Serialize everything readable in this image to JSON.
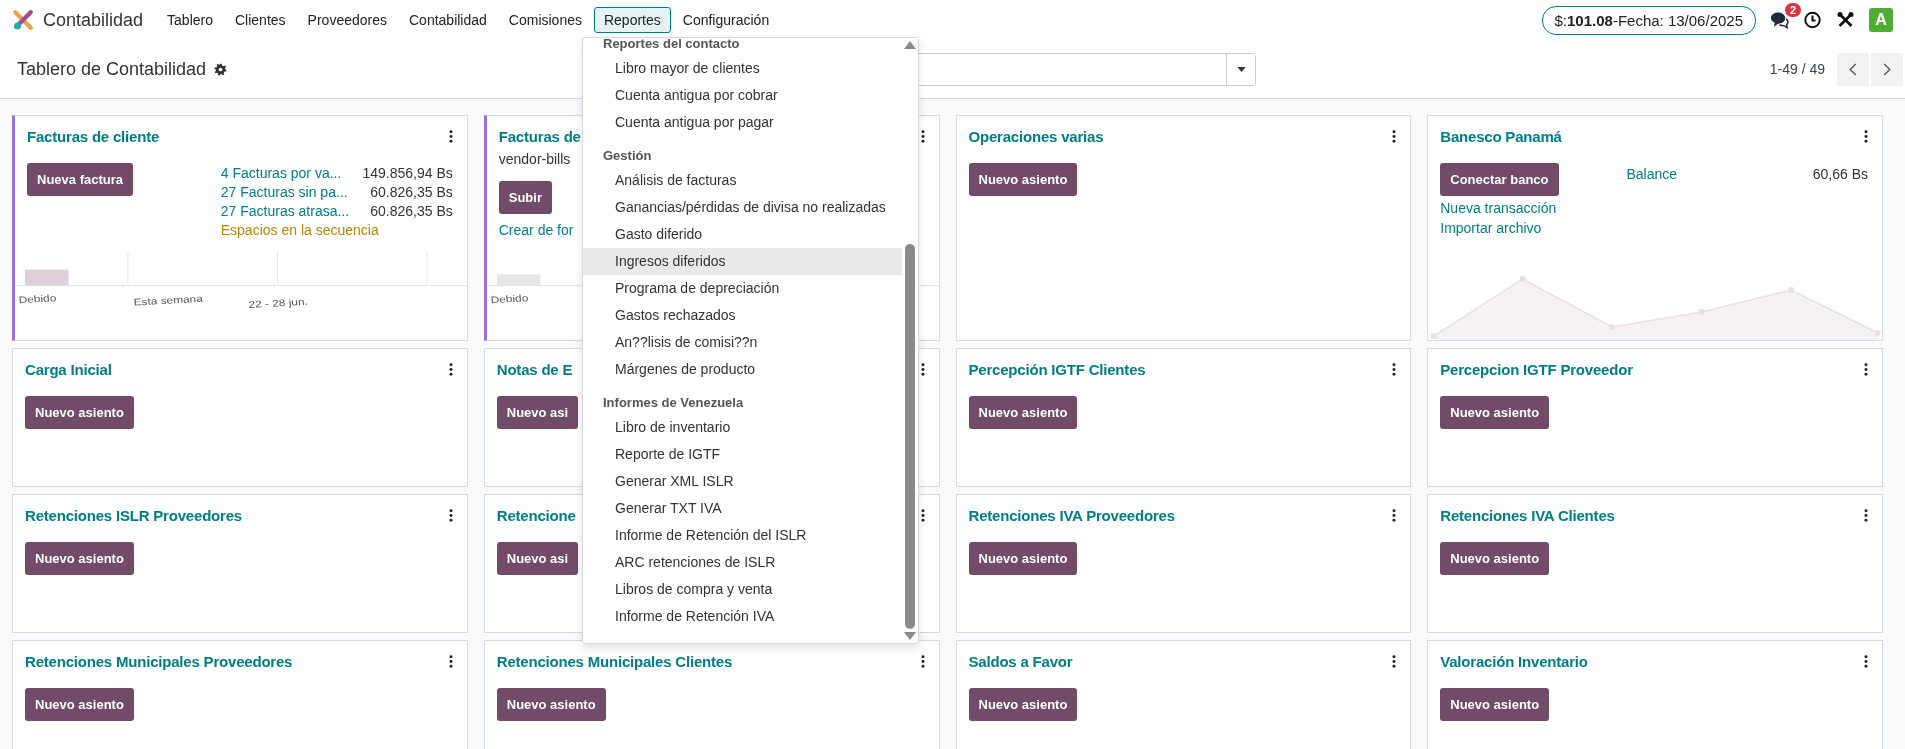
{
  "navbar": {
    "app": "Contabilidad",
    "menu": [
      {
        "label": "Tablero",
        "selected": false
      },
      {
        "label": "Clientes",
        "selected": false
      },
      {
        "label": "Proveedores",
        "selected": false
      },
      {
        "label": "Contabilidad",
        "selected": false
      },
      {
        "label": "Comisiones",
        "selected": false
      },
      {
        "label": "Reportes",
        "selected": true
      },
      {
        "label": "Configuración",
        "selected": false
      }
    ],
    "rate_pill": "$:**101.08**-Fecha: 13/06/2025",
    "messages_badge": "2",
    "avatar": "A"
  },
  "control_panel": {
    "title": "Tablero de Contabilidad",
    "pager": "1-49 / 49"
  },
  "cards": [
    {
      "kind": "sales",
      "title": "Facturas de cliente",
      "button": "Nueva factura",
      "stats": [
        {
          "label": "4 Facturas por va...",
          "amount": "149.856,94 Bs"
        },
        {
          "label": "27 Facturas sin pa...",
          "amount": "60.826,35 Bs"
        },
        {
          "label": "27 Facturas atrasa...",
          "amount": "60.826,35 Bs"
        }
      ],
      "warning": "Espacios en la secuencia",
      "chart_labels": [
        "Debido",
        "Esta semana",
        "22 - 28 jun."
      ]
    },
    {
      "kind": "purchase",
      "title": "Facturas de",
      "subtitle": "vendor-bills",
      "button": "Subir",
      "link": "Crear de for",
      "chart_labels": [
        "Debido"
      ]
    },
    {
      "kind": "general",
      "title": "Operaciones varias",
      "button": "Nuevo asiento"
    },
    {
      "kind": "bank",
      "title": "Banesco Panamá",
      "button": "Conectar banco",
      "balance_label": "Balance",
      "balance": "60,66 Bs",
      "links": [
        "Nueva transacción",
        "Importar archivo"
      ]
    },
    {
      "kind": "general",
      "title": "Carga Inicial",
      "button": "Nuevo asiento"
    },
    {
      "kind": "general",
      "title": "Notas de E",
      "button": "Nuevo asi"
    },
    {
      "kind": "general",
      "title": "Percepción IGTF Clientes",
      "button": "Nuevo asiento"
    },
    {
      "kind": "general",
      "title": "Percepcion IGTF Proveedor",
      "button": "Nuevo asiento"
    },
    {
      "kind": "general",
      "title": "Retenciones ISLR Proveedores",
      "button": "Nuevo asiento"
    },
    {
      "kind": "general",
      "title": "Retencione",
      "button": "Nuevo asi"
    },
    {
      "kind": "general",
      "title": "Retenciones IVA Proveedores",
      "button": "Nuevo asiento"
    },
    {
      "kind": "general",
      "title": "Retenciones IVA Clientes",
      "button": "Nuevo asiento"
    },
    {
      "kind": "general",
      "title": "Retenciones Municipales Proveedores",
      "button": "Nuevo asiento"
    },
    {
      "kind": "general",
      "title": "Retenciones Municipales Clientes",
      "button": "Nuevo asiento"
    },
    {
      "kind": "general",
      "title": "Saldos a Favor",
      "button": "Nuevo asiento"
    },
    {
      "kind": "general",
      "title": "Valoración Inventario",
      "button": "Nuevo asiento"
    }
  ],
  "reports_menu": {
    "sections": [
      {
        "header": "Reportes del contacto",
        "items": [
          {
            "label": "Libro mayor de clientes",
            "selected": false
          },
          {
            "label": "Cuenta antigua por cobrar",
            "selected": false
          },
          {
            "label": "Cuenta antigua por pagar",
            "selected": false
          }
        ]
      },
      {
        "header": "Gestión",
        "items": [
          {
            "label": "Análisis de facturas",
            "selected": false
          },
          {
            "label": "Ganancias/pérdidas de divisa no realizadas",
            "selected": false
          },
          {
            "label": "Gasto diferido",
            "selected": false
          },
          {
            "label": "Ingresos diferidos",
            "selected": true
          },
          {
            "label": "Programa de depreciación",
            "selected": false
          },
          {
            "label": "Gastos rechazados",
            "selected": false
          },
          {
            "label": "An??lisis de comisi??n",
            "selected": false
          },
          {
            "label": "Márgenes de producto",
            "selected": false
          }
        ]
      },
      {
        "header": "Informes de Venezuela",
        "items": [
          {
            "label": "Libro de inventario",
            "selected": false
          },
          {
            "label": "Reporte de IGTF",
            "selected": false
          },
          {
            "label": "Generar XML ISLR",
            "selected": false
          },
          {
            "label": "Generar TXT IVA",
            "selected": false
          },
          {
            "label": "Informe de Retención del ISLR",
            "selected": false
          },
          {
            "label": "ARC retenciones de ISLR",
            "selected": false
          },
          {
            "label": "Libros de compra y venta",
            "selected": false
          },
          {
            "label": "Informe de Retención IVA",
            "selected": false
          }
        ]
      }
    ]
  }
}
